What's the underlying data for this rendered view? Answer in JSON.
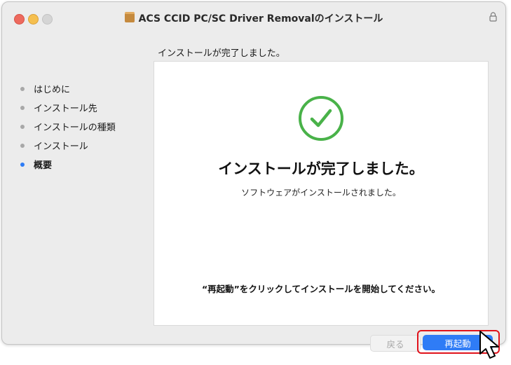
{
  "window": {
    "title": "ACS CCID PC/SC Driver Removalのインストール",
    "subtitle": "インストールが完了しました。"
  },
  "sidebar": {
    "steps": [
      {
        "label": "はじめに",
        "active": false
      },
      {
        "label": "インストール先",
        "active": false
      },
      {
        "label": "インストールの種類",
        "active": false
      },
      {
        "label": "インストール",
        "active": false
      },
      {
        "label": "概要",
        "active": true
      }
    ]
  },
  "main": {
    "title": "インストールが完了しました。",
    "message": "ソフトウェアがインストールされました。",
    "hint": "“再起動”をクリックしてインストールを開始してください。"
  },
  "buttons": {
    "back_label": "戻る",
    "restart_label": "再起動"
  },
  "colors": {
    "accent": "#2f7cf6",
    "success": "#49b249",
    "highlight": "#e0121b"
  },
  "icons": [
    "package-icon",
    "lock-icon",
    "checkmark-circle-icon",
    "mouse-cursor-icon"
  ]
}
